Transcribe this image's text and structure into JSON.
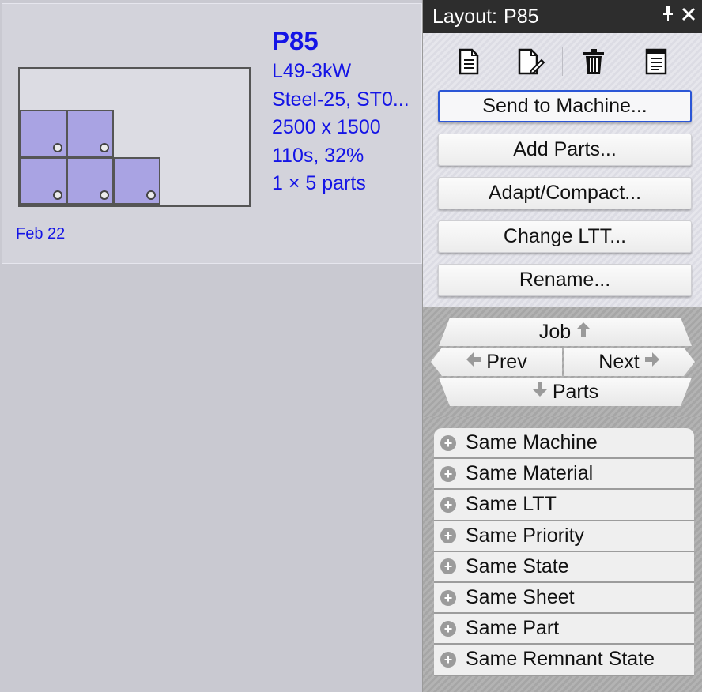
{
  "layout_card": {
    "name": "P85",
    "details": [
      "L49-3kW",
      "Steel-25, ST0...",
      "2500 x 1500",
      "110s, 32%",
      "1 × 5 parts"
    ],
    "date": "Feb 22"
  },
  "panel": {
    "title_prefix": "Layout:",
    "title": "P85",
    "title_tools": {
      "pin": "pin-icon",
      "close": "close-icon"
    },
    "toolbar_icons": [
      "new-document-icon",
      "edit-document-icon",
      "delete-trash-icon",
      "report-icon"
    ],
    "actions": [
      {
        "label": "Send to Machine..."
      },
      {
        "label": "Add Parts..."
      },
      {
        "label": "Adapt/Compact..."
      },
      {
        "label": "Change LTT..."
      },
      {
        "label": "Rename..."
      }
    ],
    "nav": {
      "job": "Job",
      "prev": "Prev",
      "next": "Next",
      "parts": "Parts"
    },
    "filters": [
      "Same Machine",
      "Same Material",
      "Same LTT",
      "Same Priority",
      "Same State",
      "Same Sheet",
      "Same Part",
      "Same Remnant State"
    ]
  },
  "colors": {
    "link_blue": "#1414e6",
    "part_fill": "#a9a3e3",
    "title_bar": "#2d2d2d",
    "focus_border": "#2b56d6"
  }
}
